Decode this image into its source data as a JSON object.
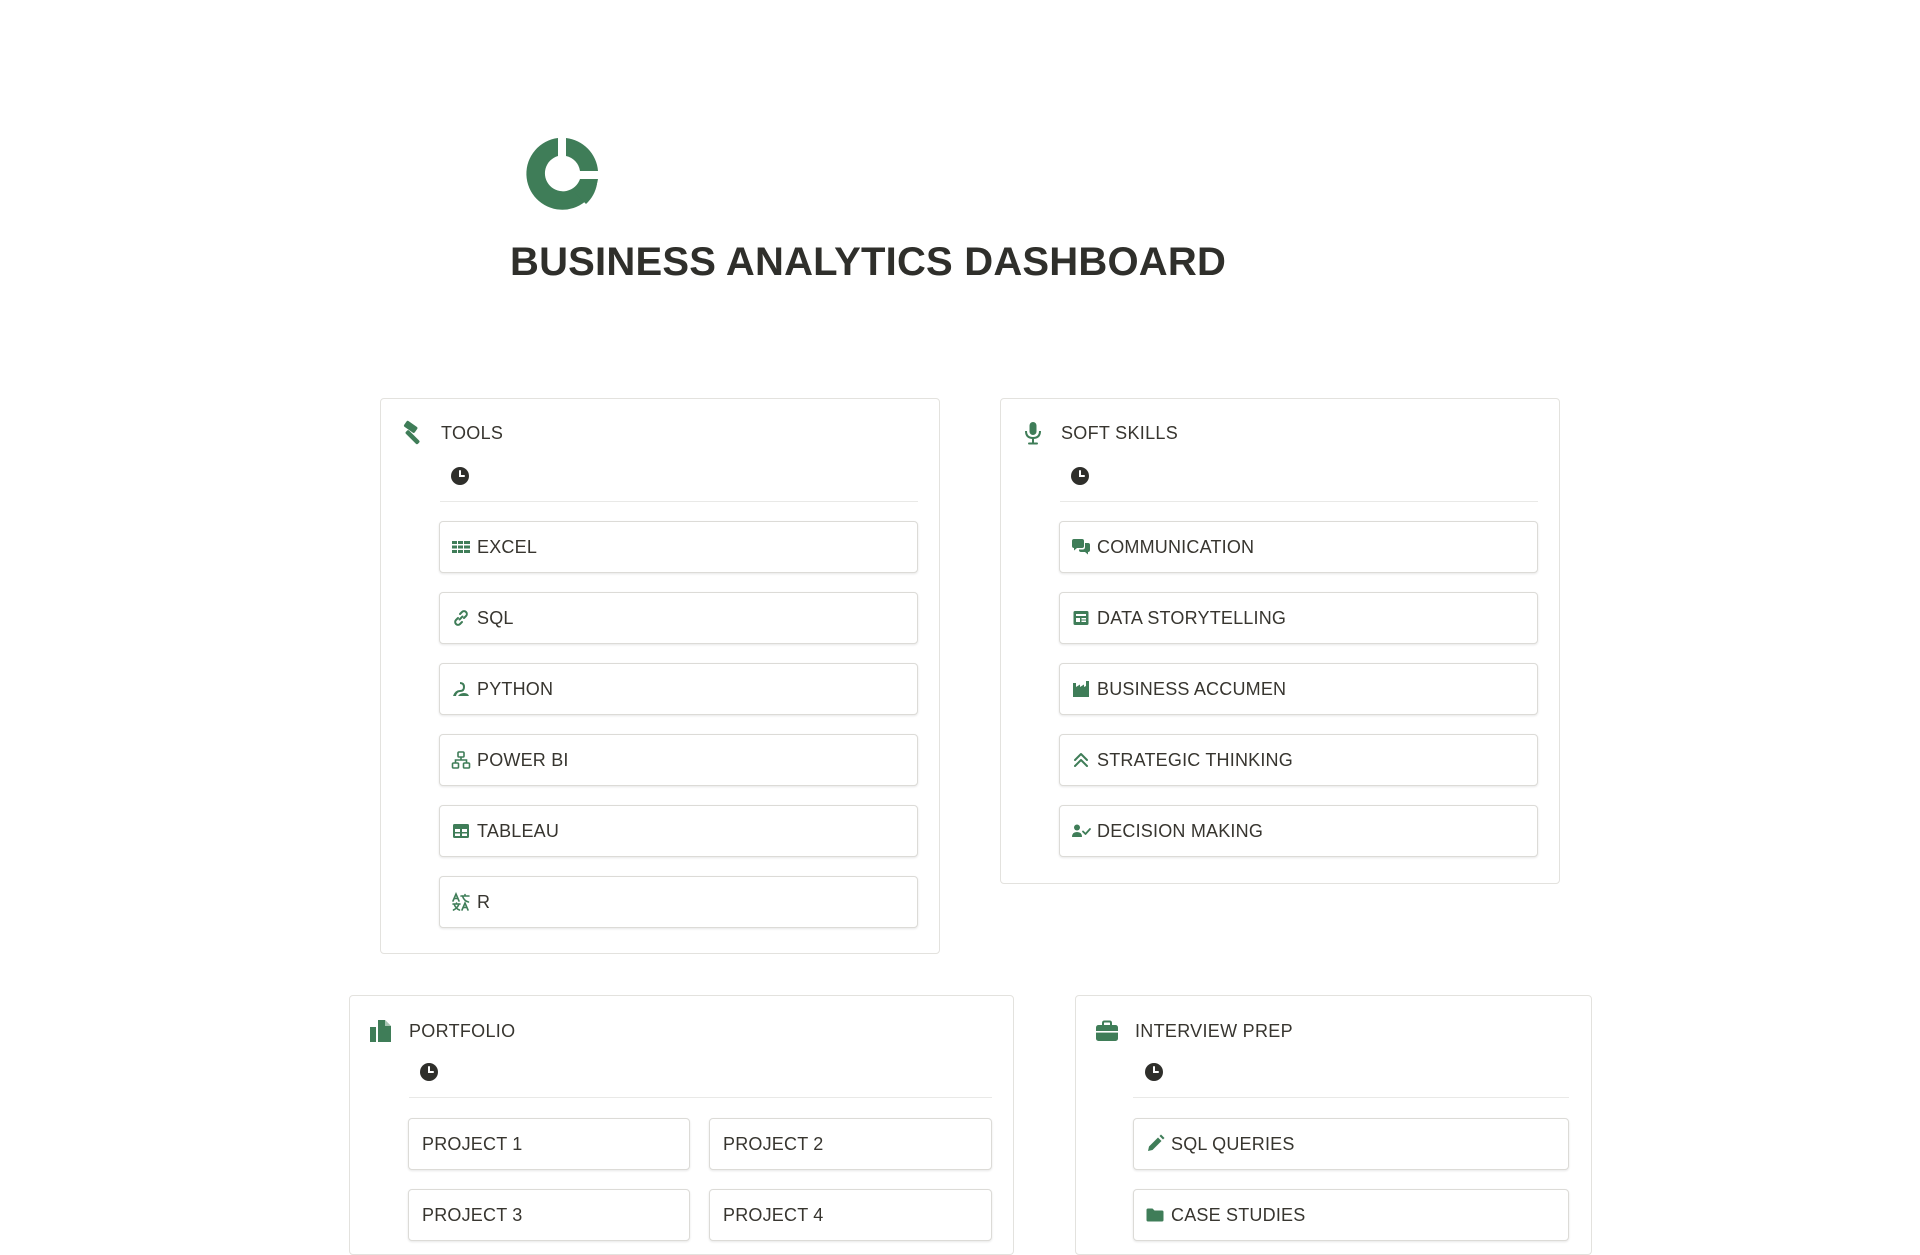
{
  "page": {
    "title": "BUSINESS ANALYTICS DASHBOARD",
    "icon": "pie-chart-icon",
    "accent_color": "#3f7d58"
  },
  "cards": {
    "tools": {
      "title": "TOOLS",
      "icon": "hammer-icon",
      "items": [
        {
          "label": "EXCEL",
          "icon": "grid-table-icon"
        },
        {
          "label": "SQL",
          "icon": "link-icon"
        },
        {
          "label": "PYTHON",
          "icon": "snake-icon"
        },
        {
          "label": "POWER BI",
          "icon": "hierarchy-icon"
        },
        {
          "label": "TABLEAU",
          "icon": "table-icon"
        },
        {
          "label": "R",
          "icon": "translate-icon"
        }
      ]
    },
    "soft_skills": {
      "title": "SOFT SKILLS",
      "icon": "microphone-icon",
      "items": [
        {
          "label": "COMMUNICATION",
          "icon": "chat-bubbles-icon"
        },
        {
          "label": "DATA STORYTELLING",
          "icon": "newspaper-icon"
        },
        {
          "label": "BUSINESS ACCUMEN",
          "icon": "factory-icon"
        },
        {
          "label": "STRATEGIC THINKING",
          "icon": "double-chevron-up-icon"
        },
        {
          "label": "DECISION MAKING",
          "icon": "person-check-icon"
        }
      ]
    },
    "portfolio": {
      "title": "PORTFOLIO",
      "icon": "documents-icon",
      "items": [
        {
          "label": "PROJECT 1"
        },
        {
          "label": "PROJECT 2"
        },
        {
          "label": "PROJECT 3"
        },
        {
          "label": "PROJECT 4"
        }
      ]
    },
    "interview_prep": {
      "title": "INTERVIEW PREP",
      "icon": "briefcase-icon",
      "items": [
        {
          "label": "SQL QUERIES",
          "icon": "pencil-icon"
        },
        {
          "label": "CASE STUDIES",
          "icon": "folder-icon"
        }
      ]
    }
  }
}
